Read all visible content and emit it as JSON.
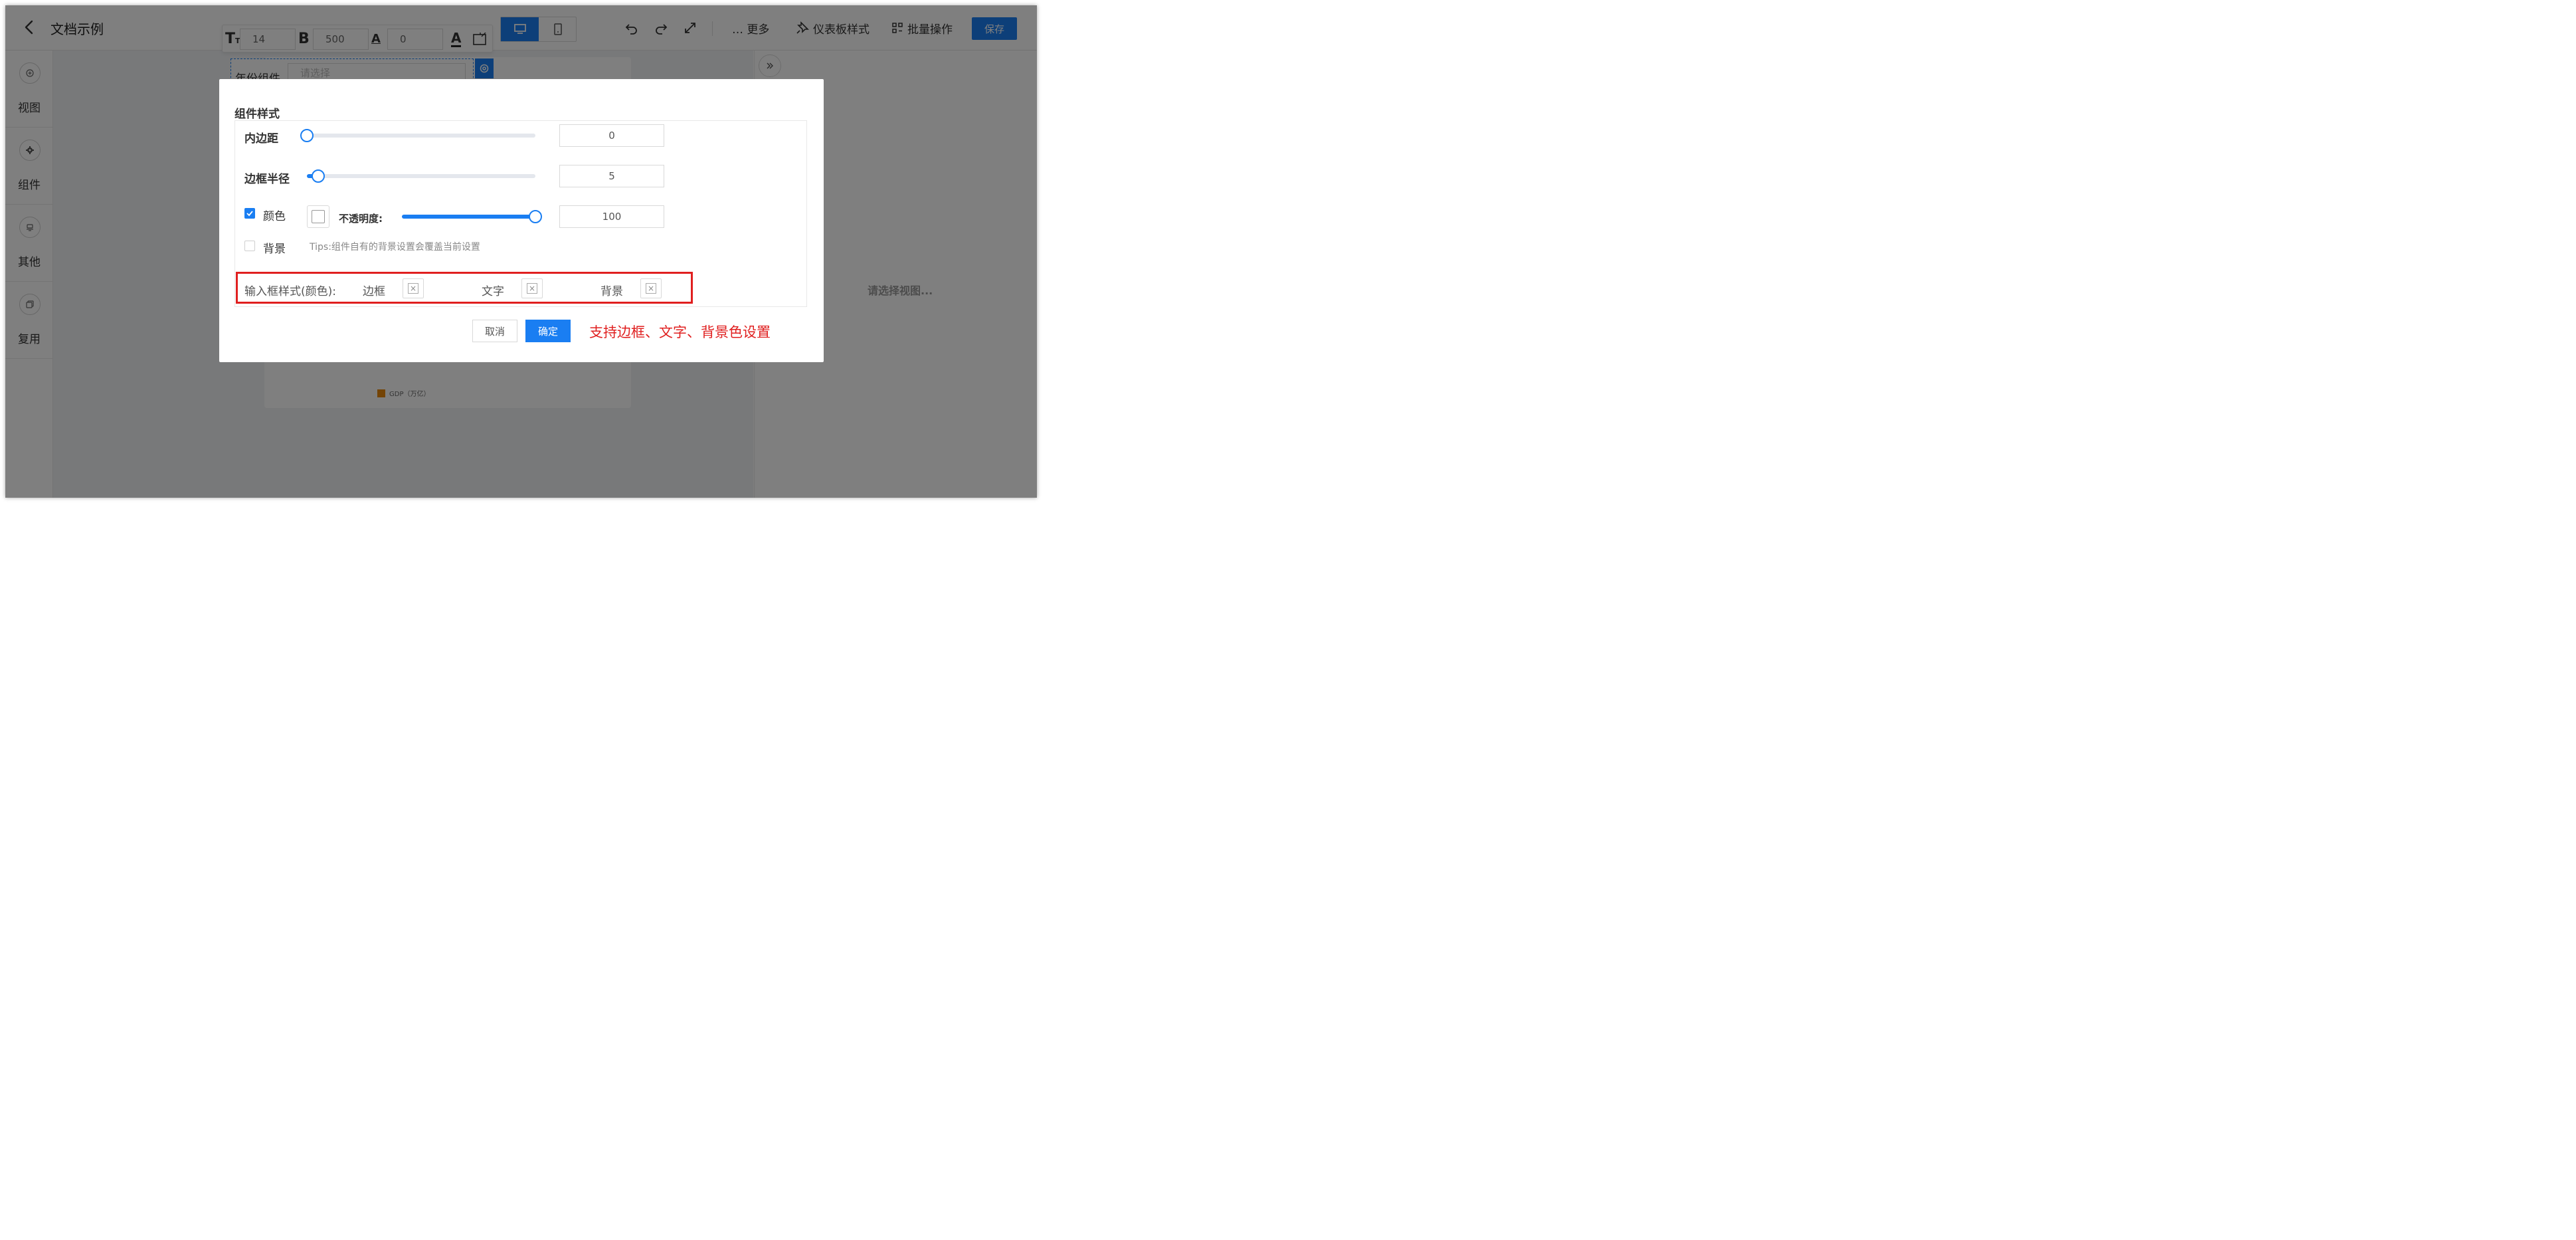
{
  "header": {
    "title": "文档示例",
    "font_toolbar": {
      "font_size": "14",
      "font_weight": "500",
      "letter_spacing": "0"
    },
    "more_label": "… 更多",
    "dashboard_style_label": "仪表板样式",
    "batch_label": "批量操作",
    "save_label": "保存"
  },
  "sidebar": {
    "items": [
      {
        "label": "视图",
        "icon": "plus-circle-icon"
      },
      {
        "label": "组件",
        "icon": "gear-icon"
      },
      {
        "label": "其他",
        "icon": "stamp-icon"
      },
      {
        "label": "复用",
        "icon": "copy-icon"
      }
    ]
  },
  "canvas": {
    "year_component_label": "年份组件",
    "year_select_placeholder": "请选择",
    "legend_label": "GDP（万亿）",
    "legend_color": "#e8890c"
  },
  "right_panel": {
    "empty_tip": "请选择视图..."
  },
  "modal": {
    "section_title": "组件样式",
    "padding": {
      "label": "内边距",
      "value": "0",
      "fraction": 0.0
    },
    "radius": {
      "label": "边框半径",
      "value": "5",
      "fraction": 0.05
    },
    "color": {
      "label": "颜色",
      "checked": true,
      "opacity_label": "不透明度:",
      "opacity_value": "100",
      "opacity_fraction": 1.0
    },
    "background": {
      "label": "背景",
      "checked": false,
      "tips": "Tips:组件自有的背景设置会覆盖当前设置"
    },
    "input_style": {
      "label": "输入框样式(颜色):",
      "border_label": "边框",
      "text_label": "文字",
      "bg_label": "背景"
    },
    "cancel_label": "取消",
    "ok_label": "确定",
    "annotation": "支持边框、文字、背景色设置"
  },
  "colors": {
    "accent": "#1a7ef2",
    "annotation_red": "#e01f1f"
  }
}
